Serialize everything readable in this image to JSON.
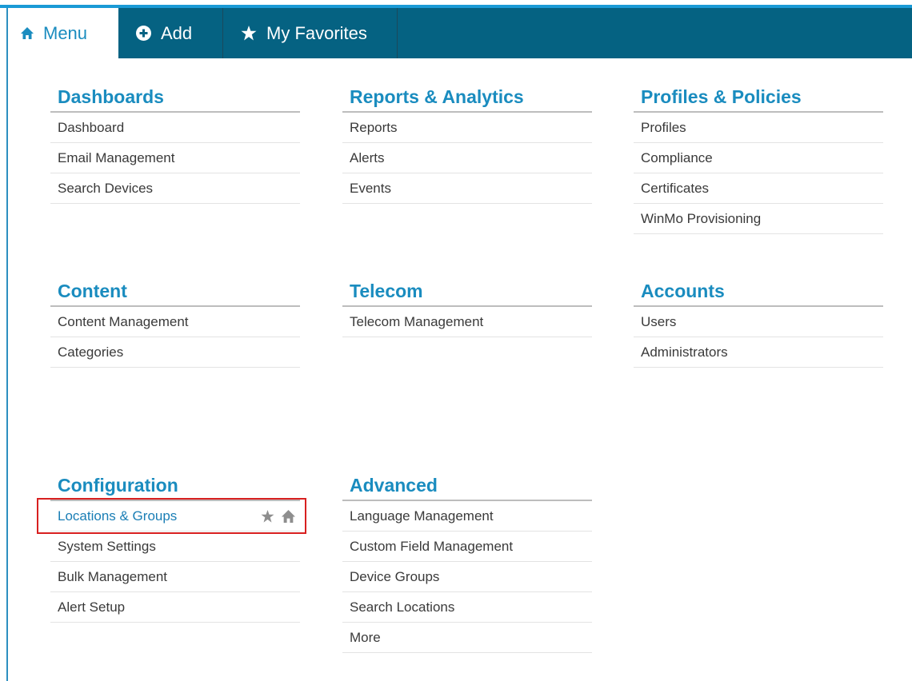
{
  "tabs": {
    "menu": "Menu",
    "add": "Add",
    "favorites": "My Favorites"
  },
  "sections": {
    "dashboards": {
      "title": "Dashboards",
      "items": [
        "Dashboard",
        "Email Management",
        "Search Devices"
      ]
    },
    "reports": {
      "title": "Reports & Analytics",
      "items": [
        "Reports",
        "Alerts",
        "Events"
      ]
    },
    "profiles": {
      "title": "Profiles & Policies",
      "items": [
        "Profiles",
        "Compliance",
        "Certificates",
        "WinMo Provisioning"
      ]
    },
    "content": {
      "title": "Content",
      "items": [
        "Content Management",
        "Categories"
      ]
    },
    "telecom": {
      "title": "Telecom",
      "items": [
        "Telecom Management"
      ]
    },
    "accounts": {
      "title": "Accounts",
      "items": [
        "Users",
        "Administrators"
      ]
    },
    "configuration": {
      "title": "Configuration",
      "items": [
        "Locations & Groups",
        "System Settings",
        "Bulk Management",
        "Alert Setup"
      ]
    },
    "advanced": {
      "title": "Advanced",
      "items": [
        "Language Management",
        "Custom Field Management",
        "Device Groups",
        "Search Locations",
        "More"
      ]
    }
  },
  "colors": {
    "tabbar": "#056282",
    "accent": "#1a8cbf",
    "highlight_border": "#d82020"
  },
  "icons": {
    "menu_tab": "home-icon",
    "add_tab": "plus-circle-icon",
    "favorites_tab": "star-icon",
    "item_favorite": "star-icon",
    "item_home": "home-icon"
  }
}
